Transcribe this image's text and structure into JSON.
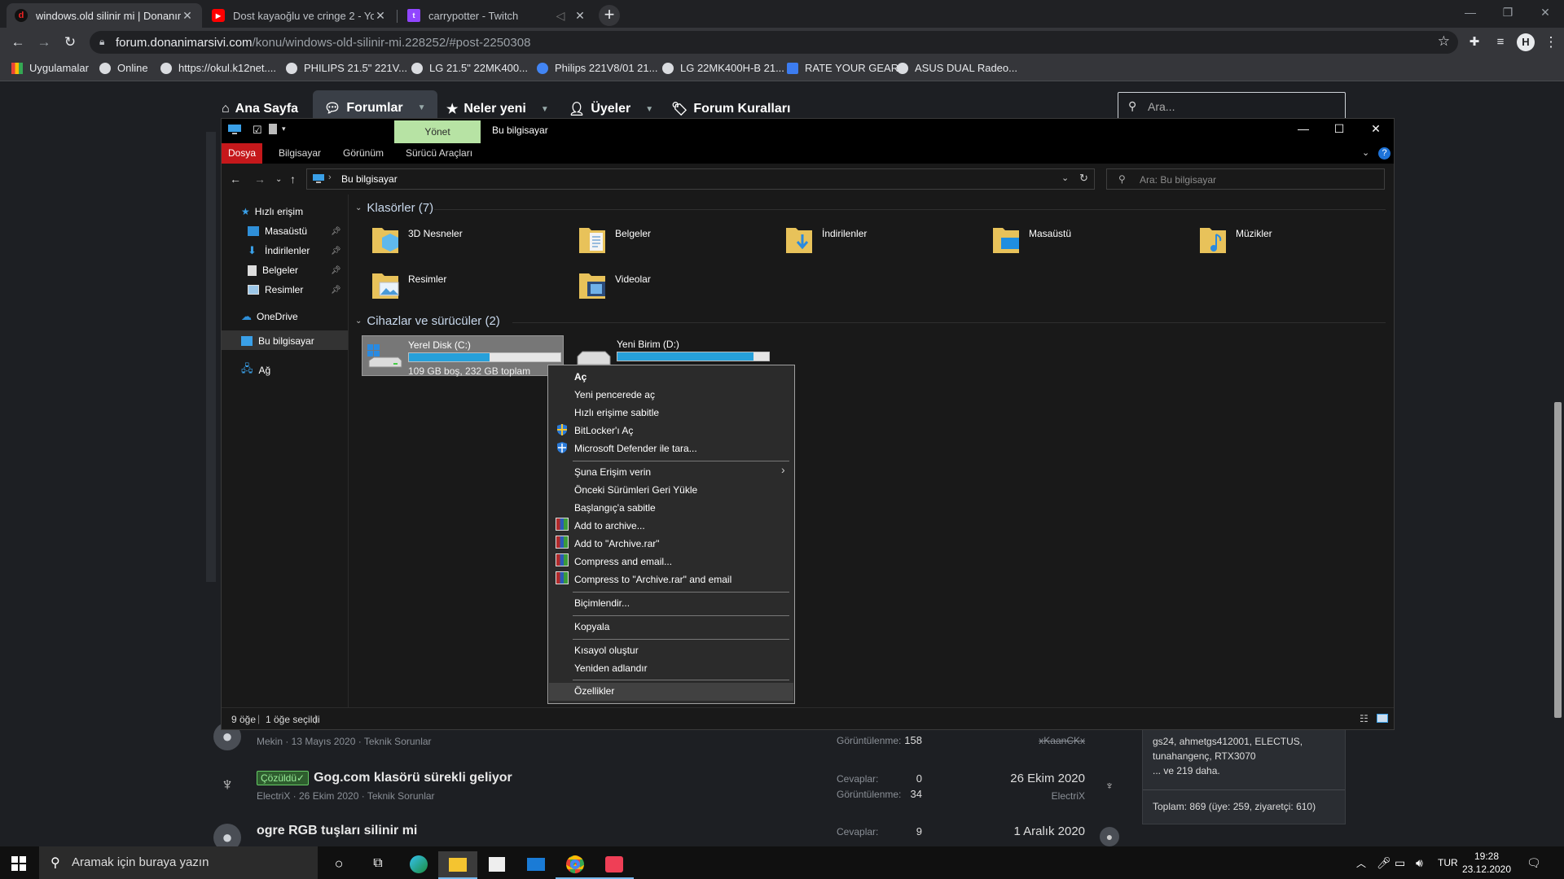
{
  "browser": {
    "tabs": [
      {
        "title": "windows.old silinir mi | Donanım",
        "active": true
      },
      {
        "title": "Dost kayaoğlu ve cringe 2 - YouT",
        "active": false
      },
      {
        "title": "carrypotter - Twitch",
        "active": false
      }
    ],
    "url_host": "forum.donanimarsivi.com",
    "url_path": "/konu/windows-old-silinir-mi.228252/#post-2250308",
    "profile_initial": "H",
    "bookmarks": [
      "Uygulamalar",
      "Online",
      "https://okul.k12net....",
      "PHILIPS 21.5\" 221V...",
      "LG 21.5\" 22MK400...",
      "Philips 221V8/01 21...",
      "LG 22MK400H-B 21...",
      "RATE YOUR GEAR",
      "ASUS DUAL Radeo..."
    ]
  },
  "forum": {
    "nav": [
      "Ana Sayfa",
      "Forumlar",
      "Neler yeni",
      "Üyeler",
      "Forum Kuralları"
    ],
    "search_placeholder": "Ara...",
    "threads": [
      {
        "title": "",
        "meta": "Mekin · 13 Mayıs 2020 · Teknik Sorunlar",
        "views_label": "Görüntülenme:",
        "views": "158",
        "last_user": "xKaanCKx"
      },
      {
        "badge": "Çözüldü✓",
        "title": "Gog.com klasörü sürekli geliyor",
        "meta": "ElectriX · 26 Ekim 2020 · Teknik Sorunlar",
        "replies_label": "Cevaplar:",
        "replies": "0",
        "views_label": "Görüntülenme:",
        "views": "34",
        "last_date": "26 Ekim 2020",
        "last_user": "ElectriX"
      },
      {
        "title": "ogre RGB tuşları silinir mi",
        "replies_label": "Cevaplar:",
        "replies": "9",
        "last_date": "1 Aralık 2020"
      }
    ],
    "online": {
      "names_line1": "gs24, ahmetgs412001, ELECTUS,",
      "names_line2": "tunahangenç, RTX3070",
      "more": "... ve 219 daha.",
      "total": "Toplam: 869 (üye: 259, ziyaretçi: 610)"
    }
  },
  "explorer": {
    "title": "Bu bilgisayar",
    "context_tab": "Yönet",
    "ribbon_tabs": [
      "Dosya",
      "Bilgisayar",
      "Görünüm",
      "Sürücü Araçları"
    ],
    "path": "Bu bilgisayar",
    "search_placeholder": "Ara: Bu bilgisayar",
    "nav": {
      "quick_access": "Hızlı erişim",
      "pinned": [
        "Masaüstü",
        "İndirilenler",
        "Belgeler",
        "Resimler"
      ],
      "onedrive": "OneDrive",
      "this_pc": "Bu bilgisayar",
      "network": "Ağ"
    },
    "folders_header": "Klasörler (7)",
    "folders": [
      "3D Nesneler",
      "Belgeler",
      "İndirilenler",
      "Masaüstü",
      "Müzikler",
      "Resimler",
      "Videolar"
    ],
    "drives_header": "Cihazlar ve sürücüler (2)",
    "drives": [
      {
        "name": "Yerel Disk (C:)",
        "detail": "109 GB boş, 232 GB toplam",
        "used_fraction": 0.53
      },
      {
        "name": "Yeni Birim (D:)",
        "used_fraction": 0.9
      }
    ],
    "status_items": "9 öğe",
    "status_selected": "1 öğe seçildi"
  },
  "context_menu": {
    "items": [
      "Aç",
      "Yeni pencerede aç",
      "Hızlı erişime sabitle",
      "BitLocker'ı Aç",
      "Microsoft Defender ile tara...",
      "Şuna Erişim verin",
      "Önceki Sürümleri Geri Yükle",
      "Başlangıç'a sabitle",
      "Add to archive...",
      "Add to \"Archive.rar\"",
      "Compress and email...",
      "Compress to \"Archive.rar\" and email",
      "Biçimlendir...",
      "Kopyala",
      "Kısayol oluştur",
      "Yeniden adlandır",
      "Özellikler"
    ]
  },
  "taskbar": {
    "search_placeholder": "Aramak için buraya yazın",
    "language": "TUR",
    "time": "19:28",
    "date": "23.12.2020"
  },
  "colors": {
    "accent_blue": "#26a0da",
    "dosya_red": "#c5181b",
    "yonet_green": "#b7e3a4"
  }
}
